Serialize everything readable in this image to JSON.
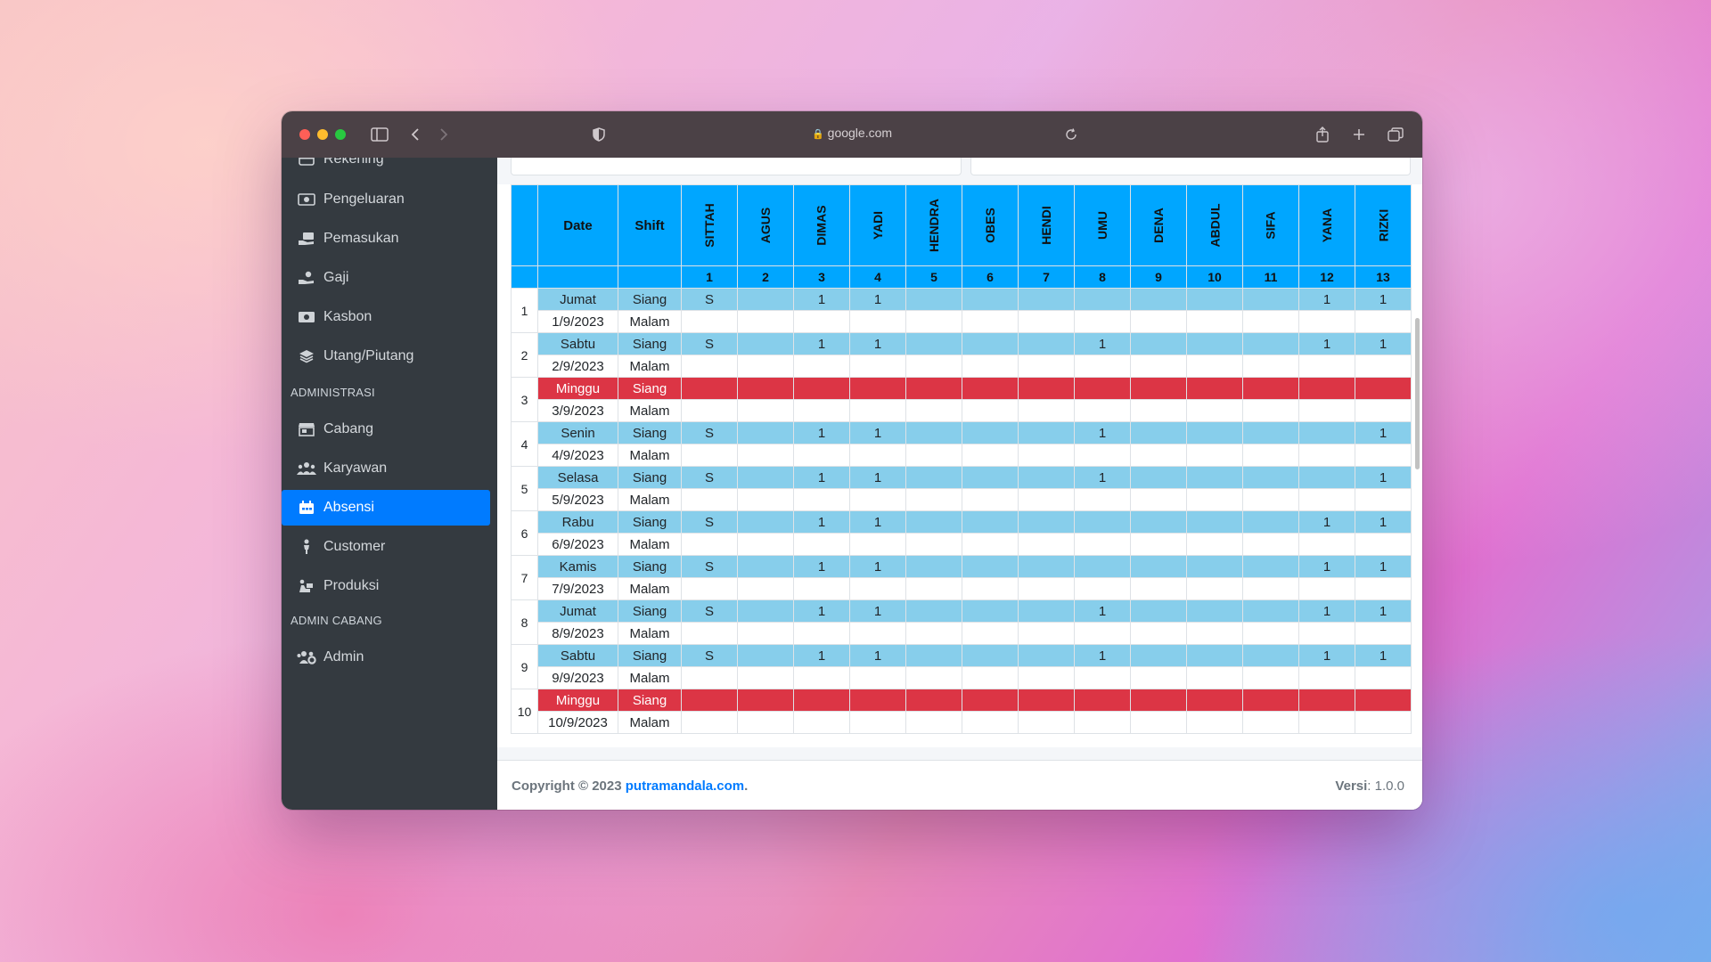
{
  "browser": {
    "url": "google.com"
  },
  "sidebar": {
    "items_top": [
      {
        "label": "Rekening",
        "icon": "credit-card-icon"
      },
      {
        "label": "Pengeluaran",
        "icon": "money-bill-icon"
      },
      {
        "label": "Pemasukan",
        "icon": "hand-money-icon"
      },
      {
        "label": "Gaji",
        "icon": "hand-coin-icon"
      },
      {
        "label": "Kasbon",
        "icon": "cash-icon"
      },
      {
        "label": "Utang/Piutang",
        "icon": "layers-icon"
      }
    ],
    "header_admin": "ADMINISTRASI",
    "items_admin": [
      {
        "label": "Cabang",
        "icon": "store-icon"
      },
      {
        "label": "Karyawan",
        "icon": "users-icon"
      },
      {
        "label": "Absensi",
        "icon": "calendar-check-icon",
        "active": true
      },
      {
        "label": "Customer",
        "icon": "person-icon"
      },
      {
        "label": "Produksi",
        "icon": "people-carry-icon"
      }
    ],
    "header_cabang": "ADMIN CABANG",
    "items_cabang": [
      {
        "label": "Admin",
        "icon": "users-cog-icon"
      }
    ]
  },
  "table": {
    "col_date": "Date",
    "col_shift": "Shift",
    "employees": [
      "SITTAH",
      "AGUS",
      "DIMAS",
      "YADI",
      "HENDRA",
      "OBES",
      "HENDI",
      "UMU",
      "DENA",
      "ABDUL",
      "SIFA",
      "YANA",
      "RIZKI"
    ],
    "employee_numbers": [
      "1",
      "2",
      "3",
      "4",
      "5",
      "6",
      "7",
      "8",
      "9",
      "10",
      "11",
      "12",
      "13"
    ],
    "shift_day": "Siang",
    "shift_night": "Malam",
    "rows": [
      {
        "no": "1",
        "day": "Jumat",
        "date": "1/9/2023",
        "holiday": false,
        "siang": [
          "S",
          "",
          "1",
          "1",
          "",
          "",
          "",
          "",
          "",
          "",
          "",
          "1",
          "1"
        ]
      },
      {
        "no": "2",
        "day": "Sabtu",
        "date": "2/9/2023",
        "holiday": false,
        "siang": [
          "S",
          "",
          "1",
          "1",
          "",
          "",
          "",
          "1",
          "",
          "",
          "",
          "1",
          "1"
        ]
      },
      {
        "no": "3",
        "day": "Minggu",
        "date": "3/9/2023",
        "holiday": true,
        "siang": [
          "",
          "",
          "",
          "",
          "",
          "",
          "",
          "",
          "",
          "",
          "",
          "",
          ""
        ]
      },
      {
        "no": "4",
        "day": "Senin",
        "date": "4/9/2023",
        "holiday": false,
        "siang": [
          "S",
          "",
          "1",
          "1",
          "",
          "",
          "",
          "1",
          "",
          "",
          "",
          "",
          "1"
        ]
      },
      {
        "no": "5",
        "day": "Selasa",
        "date": "5/9/2023",
        "holiday": false,
        "siang": [
          "S",
          "",
          "1",
          "1",
          "",
          "",
          "",
          "1",
          "",
          "",
          "",
          "",
          "1"
        ]
      },
      {
        "no": "6",
        "day": "Rabu",
        "date": "6/9/2023",
        "holiday": false,
        "siang": [
          "S",
          "",
          "1",
          "1",
          "",
          "",
          "",
          "",
          "",
          "",
          "",
          "1",
          "1"
        ]
      },
      {
        "no": "7",
        "day": "Kamis",
        "date": "7/9/2023",
        "holiday": false,
        "siang": [
          "S",
          "",
          "1",
          "1",
          "",
          "",
          "",
          "",
          "",
          "",
          "",
          "1",
          "1"
        ]
      },
      {
        "no": "8",
        "day": "Jumat",
        "date": "8/9/2023",
        "holiday": false,
        "siang": [
          "S",
          "",
          "1",
          "1",
          "",
          "",
          "",
          "1",
          "",
          "",
          "",
          "1",
          "1"
        ]
      },
      {
        "no": "9",
        "day": "Sabtu",
        "date": "9/9/2023",
        "holiday": false,
        "siang": [
          "S",
          "",
          "1",
          "1",
          "",
          "",
          "",
          "1",
          "",
          "",
          "",
          "1",
          "1"
        ]
      },
      {
        "no": "10",
        "day": "Minggu",
        "date": "10/9/2023",
        "holiday": true,
        "siang": [
          "",
          "",
          "",
          "",
          "",
          "",
          "",
          "",
          "",
          "",
          "",
          "",
          ""
        ]
      }
    ]
  },
  "footer": {
    "copyright": "Copyright © 2023",
    "site": "putramandala.com",
    "dot": ".",
    "version_label": "Versi",
    "version_value": ": 1.0.0"
  },
  "colors": {
    "header_blue": "#00a6ff",
    "siang_blue": "#87ceeb",
    "holiday_red": "#dc3545",
    "sidebar": "#343a40",
    "active": "#007bff"
  }
}
